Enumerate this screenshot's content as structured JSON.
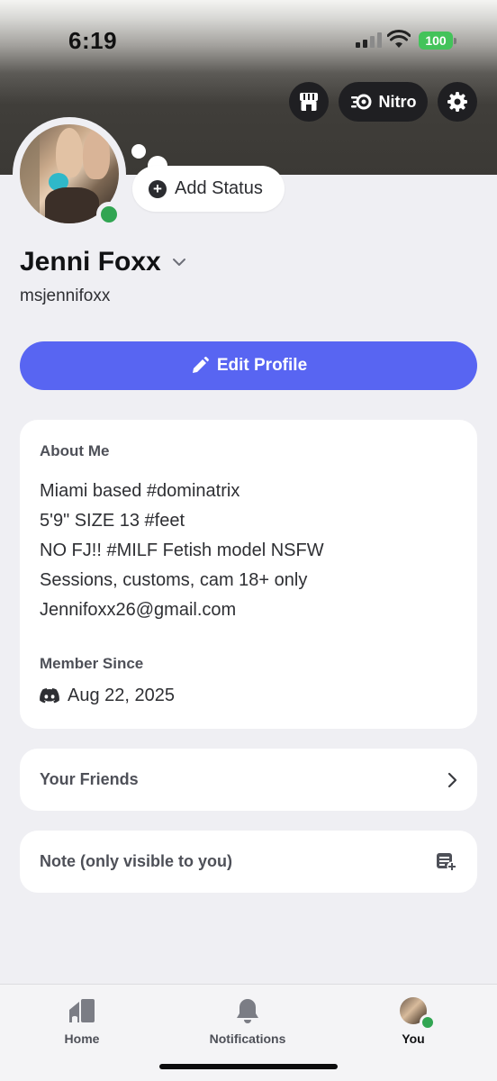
{
  "status_bar": {
    "time": "6:19",
    "battery": "100"
  },
  "header": {
    "nitro_label": "Nitro"
  },
  "profile": {
    "add_status_label": "Add Status",
    "display_name": "Jenni Foxx",
    "username": "msjennifoxx",
    "edit_profile_label": "Edit Profile"
  },
  "about": {
    "heading": "About Me",
    "lines": [
      "Miami based #dominatrix",
      "5'9\" SIZE 13 #feet",
      "NO FJ!! #MILF Fetish model NSFW",
      "Sessions, customs, cam 18+ only",
      "Jennifoxx26@gmail.com"
    ],
    "member_since_heading": "Member Since",
    "member_since_date": "Aug 22, 2025"
  },
  "friends_row": {
    "label": "Your Friends"
  },
  "note_row": {
    "label": "Note (only visible to you)"
  },
  "tabbar": {
    "home": "Home",
    "notifications": "Notifications",
    "you": "You"
  },
  "colors": {
    "accent": "#5865f2",
    "online": "#31a552",
    "battery": "#43c35a"
  }
}
